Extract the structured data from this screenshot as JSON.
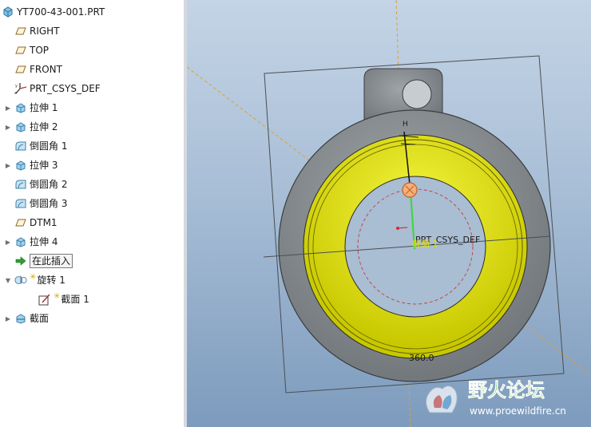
{
  "tree": {
    "root_label": "YT700-43-001.PRT",
    "items": [
      {
        "label": "RIGHT",
        "icon": "datum-plane-icon",
        "expandable": false,
        "indent": 0
      },
      {
        "label": "TOP",
        "icon": "datum-plane-icon",
        "expandable": false,
        "indent": 0
      },
      {
        "label": "FRONT",
        "icon": "datum-plane-icon",
        "expandable": false,
        "indent": 0
      },
      {
        "label": "PRT_CSYS_DEF",
        "icon": "csys-icon",
        "expandable": false,
        "indent": 0
      },
      {
        "label": "拉伸 1",
        "icon": "extrude-icon",
        "expandable": true,
        "indent": 0
      },
      {
        "label": "拉伸 2",
        "icon": "extrude-icon",
        "expandable": true,
        "indent": 0
      },
      {
        "label": "倒圆角 1",
        "icon": "round-icon",
        "expandable": false,
        "indent": 0
      },
      {
        "label": "拉伸 3",
        "icon": "extrude-icon",
        "expandable": true,
        "indent": 0
      },
      {
        "label": "倒圆角 2",
        "icon": "round-icon",
        "expandable": false,
        "indent": 0
      },
      {
        "label": "倒圆角 3",
        "icon": "round-icon",
        "expandable": false,
        "indent": 0
      },
      {
        "label": "DTM1",
        "icon": "datum-plane-icon",
        "expandable": false,
        "indent": 0
      },
      {
        "label": "拉伸 4",
        "icon": "extrude-icon",
        "expandable": true,
        "indent": 0
      },
      {
        "label": "在此插入",
        "icon": "insert-arrow-icon",
        "expandable": false,
        "indent": 0,
        "boxed": true
      },
      {
        "label": "旋转 1",
        "icon": "revolve-icon",
        "expandable": true,
        "expanded": true,
        "indent": 0,
        "star": true
      },
      {
        "label": "截面 1",
        "icon": "sketch-icon",
        "expandable": false,
        "indent": 1,
        "star": true
      },
      {
        "label": "截面",
        "icon": "section-icon",
        "expandable": true,
        "indent": 0
      }
    ]
  },
  "viewport": {
    "csys_label": "PRT_CSYS_DEF",
    "section_label": "截面 1",
    "angle_dim": "360.0",
    "h_label": "H"
  },
  "watermark": {
    "title": "野火论坛",
    "url": "www.proewildfire.cn"
  },
  "colors": {
    "viewport_top": "#c4d4e6",
    "viewport_bottom": "#7d9bbd",
    "part_gray": "#8c9194",
    "ring_yellow": "#e6e600",
    "sketch_green": "#38d838",
    "datum_orange": "#e0a030",
    "watermark_green": "#4caf2a"
  }
}
